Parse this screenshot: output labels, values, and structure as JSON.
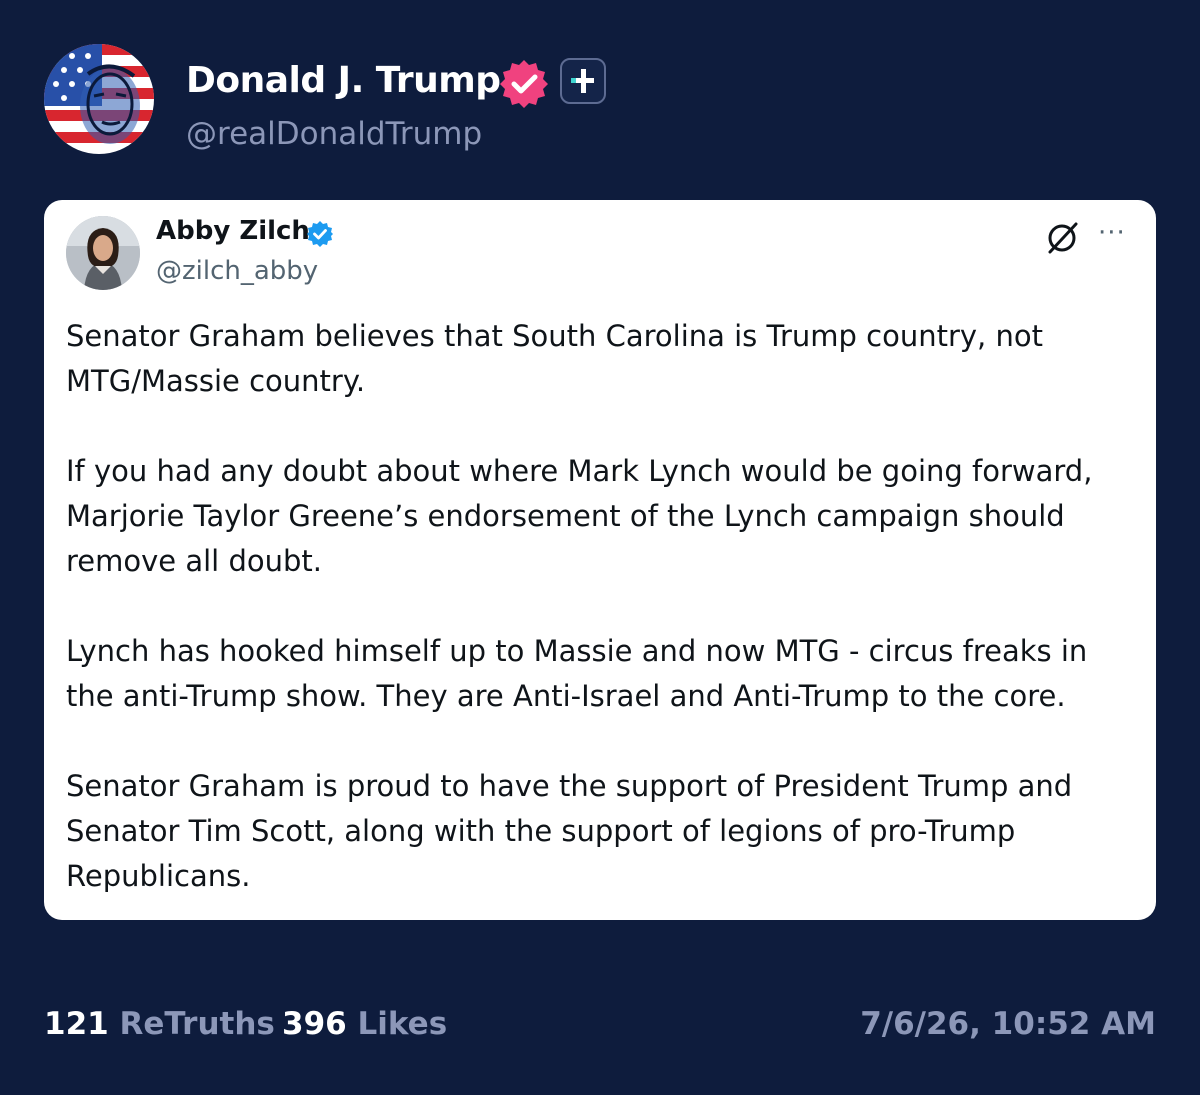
{
  "post": {
    "author": {
      "display_name": "Donald J. Trump",
      "handle": "@realDonaldTrump",
      "avatar_icon": "flag-portrait-avatar",
      "verified_icon": "verified-badge-icon",
      "plus_icon": "plus-icon"
    },
    "quoted": {
      "author": {
        "display_name": "Abby Zilch",
        "handle": "@zilch_abby",
        "avatar_icon": "woman-portrait-avatar"
      },
      "paragraphs": [
        "Senator Graham believes that South Carolina is Trump country, not MTG/Massie country.",
        "If you had any doubt about where Mark Lynch would be going forward, Marjorie Taylor Greene’s endorsement of the Lynch campaign should remove all doubt.",
        "Lynch has hooked himself up to Massie and now MTG - circus freaks in the anti-Trump show. They are Anti-Israel and Anti-Trump to the core.",
        "Senator Graham is proud to have the support of President Trump and Senator Tim Scott, along with the support of legions of pro-Trump Republicans."
      ],
      "more_label": "···"
    },
    "stats": {
      "retruths_count": "121",
      "retruths_label": "ReTruths",
      "likes_count": "396",
      "likes_label": "Likes"
    },
    "timestamp": "7/6/26, 10:52 AM"
  },
  "colors": {
    "background": "#0e1c3d",
    "verified_pink": "#f0427f",
    "verified_blue": "#1d9bf0",
    "muted_text": "#8c97b8"
  }
}
